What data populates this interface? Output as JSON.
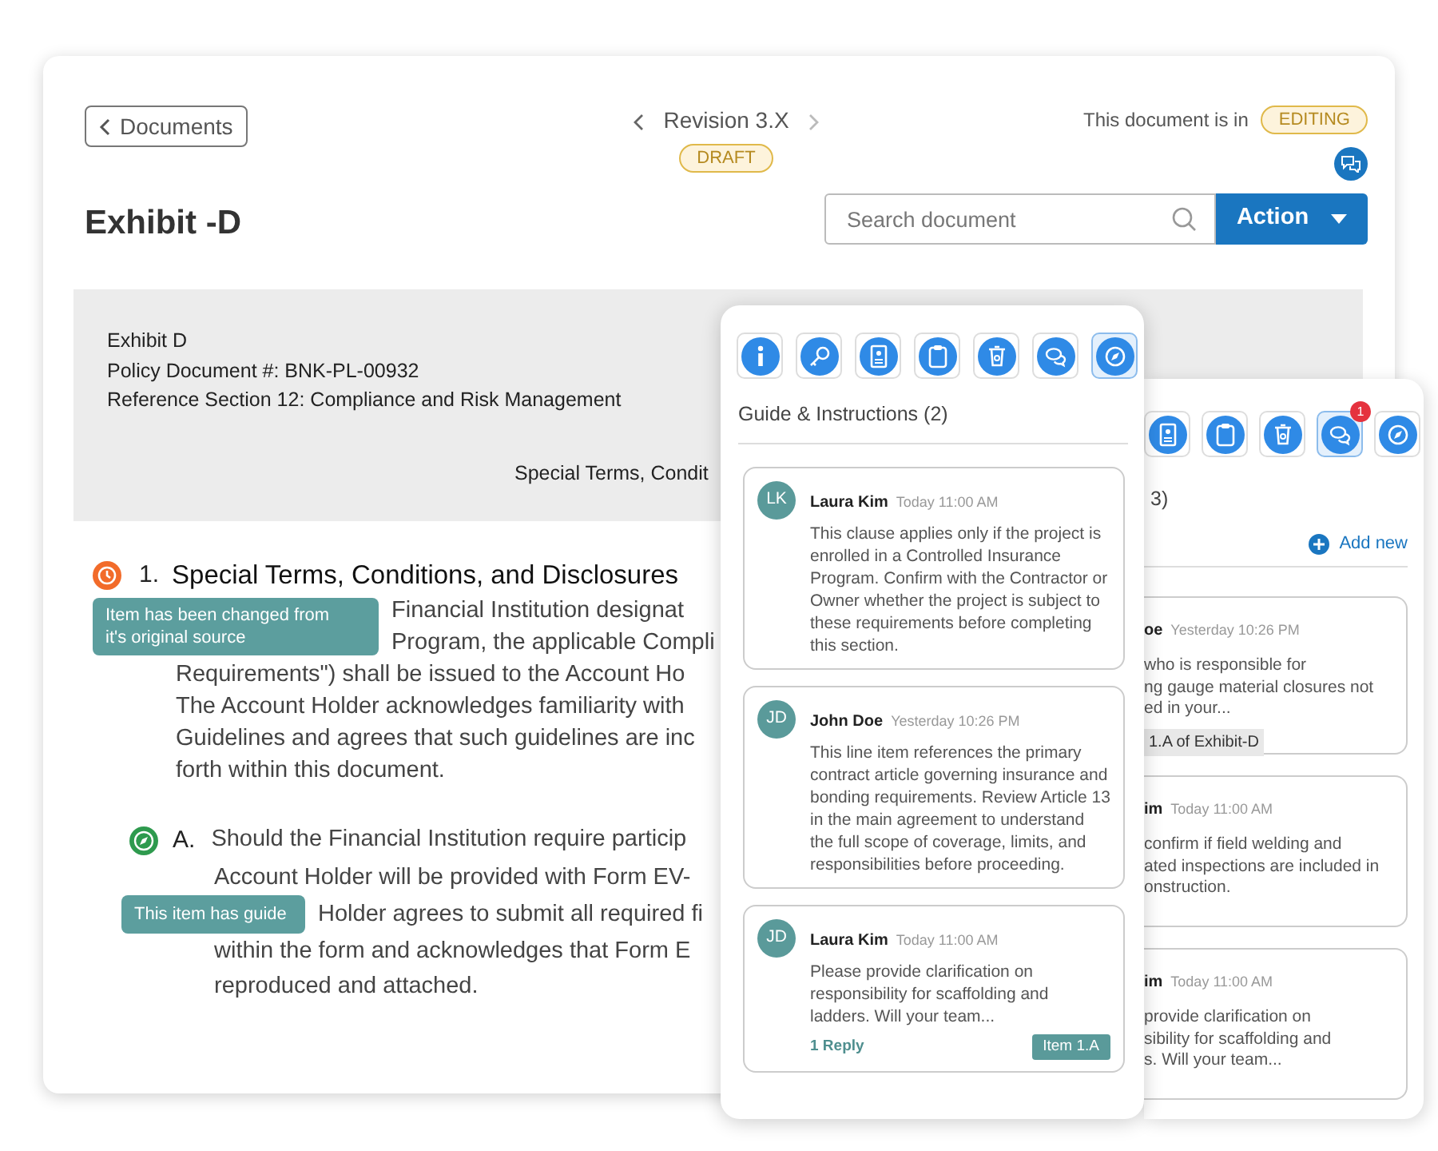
{
  "main": {
    "back_button": "Documents",
    "revision": {
      "label": "Revision 3.X",
      "badge": "DRAFT"
    },
    "status": {
      "text": "This document is in",
      "badge": "EDITING"
    },
    "title": "Exhibit -D",
    "search": {
      "placeholder": "Search document"
    },
    "action_button": "Action",
    "header_lines": [
      "Exhibit D",
      "Policy Document #: BNK-PL-00932",
      "Reference Section 12: Compliance and Risk Management"
    ],
    "header_center": "Special Terms, Condit",
    "sections": [
      {
        "kind": "changed",
        "number": "1.",
        "title": "Special Terms, Conditions, and Disclosures",
        "lines": [
          {
            "kind": "tooltip",
            "text": "Item has been changed from it's original source",
            "lines": [
              "Financial Institution designat",
              "Program, the applicable Compli"
            ]
          },
          {
            "kind": "text",
            "text": "Requirements\") shall be issued to the Account Ho"
          },
          {
            "kind": "text",
            "text": "The Account Holder acknowledges familiarity with"
          },
          {
            "kind": "text",
            "text": "Guidelines and agrees that such guidelines are inc"
          },
          {
            "kind": "text",
            "text": "forth within this document."
          }
        ],
        "children": [
          {
            "kind": "guide",
            "number": "A.",
            "title": "Should the Financial Institution require particip",
            "lines": [
              {
                "kind": "text",
                "text": "Account Holder will be provided with Form EV-"
              },
              {
                "kind": "tooltip",
                "text": "This item has guide",
                "lines": [
                  "Holder agrees to submit all required fi"
                ]
              },
              {
                "kind": "text",
                "text": "within the form and acknowledges that Form E"
              },
              {
                "kind": "text",
                "text": "reproduced and attached."
              }
            ]
          }
        ]
      }
    ]
  },
  "guide_panel": {
    "tools": [
      {
        "kind": "info",
        "selected": false
      },
      {
        "kind": "key",
        "selected": false
      },
      {
        "kind": "card",
        "selected": false
      },
      {
        "kind": "clipboard",
        "selected": false
      },
      {
        "kind": "trash",
        "selected": false
      },
      {
        "kind": "chat",
        "selected": false
      },
      {
        "kind": "compass",
        "selected": true
      }
    ],
    "heading": "Guide & Instructions (2)",
    "notes": [
      {
        "initials": "LK",
        "author": "Laura Kim",
        "time": "Today 11:00 AM",
        "text": "This clause applies only if the project is enrolled in a Controlled Insurance Program. Confirm with the Contractor or Owner whether the project is subject to these requirements before completing this section."
      },
      {
        "initials": "JD",
        "author": "John Doe",
        "time": "Yesterday 10:26 PM",
        "text": "This line item references the primary contract article governing insurance and bonding requirements. Review Article 13 in the main agreement to understand the full scope of coverage, limits, and responsibilities before proceeding."
      },
      {
        "initials": "JD",
        "author": "Laura Kim",
        "time": "Today 11:00 AM",
        "text": "Please provide clarification on responsibility for scaffolding and ladders. Will your team...",
        "reply": "1 Reply",
        "tag": "Item 1.A"
      }
    ]
  },
  "comments_panel": {
    "tools": [
      {
        "kind": "card",
        "selected": false
      },
      {
        "kind": "clipboard",
        "selected": false
      },
      {
        "kind": "trash",
        "selected": false
      },
      {
        "kind": "chat",
        "selected": true,
        "badge": "1"
      },
      {
        "kind": "compass",
        "selected": false
      }
    ],
    "heading": "3)",
    "add_button": "Add new",
    "comments": [
      {
        "author": "oe",
        "time": "Yesterday 10:26 PM",
        "lines": [
          "who is responsible for",
          "ng gauge material closures not",
          "ed in your..."
        ],
        "tag": "1.A of Exhibit-D"
      },
      {
        "author": "im",
        "time": "Today 11:00 AM",
        "lines": [
          "confirm if field welding and",
          "ated inspections are included in",
          "onstruction."
        ]
      },
      {
        "author": "im",
        "time": "Today 11:00 AM",
        "lines": [
          "provide clarification on",
          "sibility for scaffolding and",
          "s. Will your team..."
        ]
      }
    ]
  }
}
